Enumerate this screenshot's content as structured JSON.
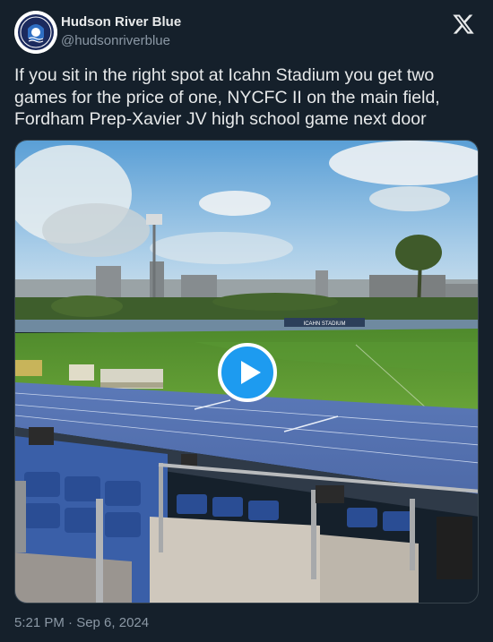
{
  "author": {
    "display_name": "Hudson River Blue",
    "handle": "@hudsonriverblue"
  },
  "icons": {
    "avatar": "hudson-river-blue-logo",
    "platform": "x-logo",
    "play": "play-icon"
  },
  "tweet": {
    "text": "If you sit in the right spot at Icahn Stadium you get two games for the price of one, NYCFC II on the main field, Fordham Prep-Xavier JV high school game next door",
    "timestamp": "5:21 PM · Sep 6, 2024"
  },
  "media": {
    "type": "video",
    "stadium_sign": "ICAHN STADIUM"
  },
  "colors": {
    "background": "#15202b",
    "accent": "#1d9bf0",
    "text_primary": "#e7e9ea",
    "text_secondary": "#8b98a5"
  }
}
